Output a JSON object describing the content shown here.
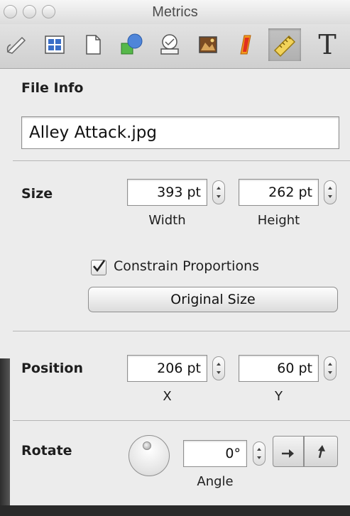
{
  "window": {
    "title": "Metrics"
  },
  "toolbar": {
    "tools": [
      {
        "icon": "document-inspector-icon"
      },
      {
        "icon": "layout-inspector-icon"
      },
      {
        "icon": "page-inspector-icon"
      },
      {
        "icon": "shape-inspector-icon"
      },
      {
        "icon": "mail-merge-icon"
      },
      {
        "icon": "image-inspector-icon"
      },
      {
        "icon": "text-color-icon"
      },
      {
        "icon": "metrics-ruler-icon",
        "active": true
      },
      {
        "icon": "text-inspector-icon",
        "glyph": "T"
      }
    ]
  },
  "file_info": {
    "label": "File Info",
    "filename": "Alley Attack.jpg"
  },
  "size": {
    "label": "Size",
    "width_value": "393 pt",
    "width_caption": "Width",
    "height_value": "262 pt",
    "height_caption": "Height",
    "constrain_label": "Constrain Proportions",
    "constrain_checked": true,
    "original_size_label": "Original Size"
  },
  "position": {
    "label": "Position",
    "x_value": "206 pt",
    "x_caption": "X",
    "y_value": "60 pt",
    "y_caption": "Y"
  },
  "rotate": {
    "label": "Rotate",
    "angle_value": "0°",
    "angle_caption": "Angle"
  },
  "colors": {
    "window_bg": "#ececec",
    "accent_blue": "#3b6fc8"
  }
}
